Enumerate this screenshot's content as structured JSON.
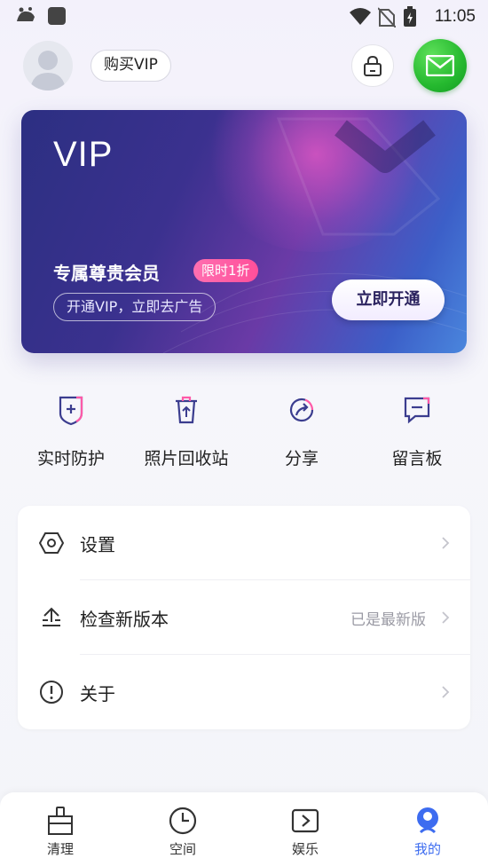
{
  "status_bar": {
    "time": "11:05"
  },
  "header": {
    "buy_vip_label": "购买VIP"
  },
  "vip_card": {
    "title": "VIP",
    "subtitle": "专属尊贵会员",
    "badge": "限时1折",
    "description": "开通VIP，立即去广告",
    "open_button": "立即开通"
  },
  "quick_actions": [
    {
      "label": "实时防护",
      "icon": "shield-plus-icon"
    },
    {
      "label": "照片回收站",
      "icon": "trash-bin-icon"
    },
    {
      "label": "分享",
      "icon": "share-icon"
    },
    {
      "label": "留言板",
      "icon": "message-board-icon"
    }
  ],
  "settings": [
    {
      "label": "设置",
      "value": "",
      "icon": "hexagon-settings-icon"
    },
    {
      "label": "检查新版本",
      "value": "已是最新版",
      "icon": "upload-update-icon"
    },
    {
      "label": "关于",
      "value": "",
      "icon": "info-exclamation-icon"
    }
  ],
  "bottom_nav": [
    {
      "label": "清理",
      "icon": "broom-icon"
    },
    {
      "label": "空间",
      "icon": "clock-icon"
    },
    {
      "label": "娱乐",
      "icon": "play-icon"
    },
    {
      "label": "我的",
      "icon": "profile-icon",
      "active": true
    }
  ],
  "colors": {
    "accent": "#3d6cf0",
    "vip_badge": "#ff4f9a",
    "mail": "#25b92f"
  }
}
